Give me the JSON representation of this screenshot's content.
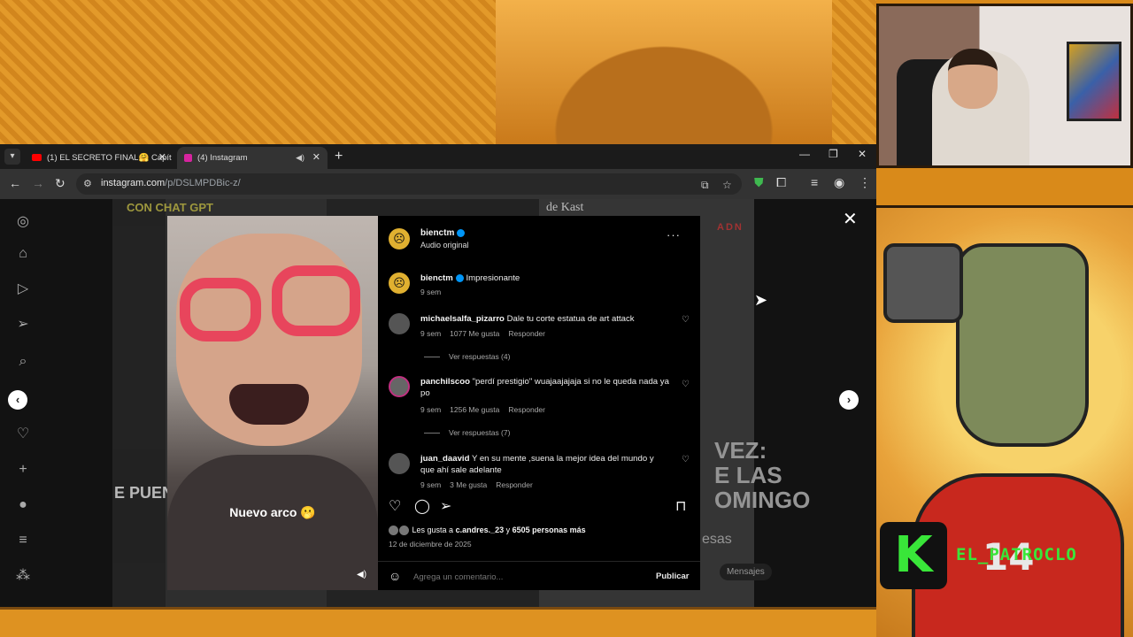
{
  "browser": {
    "tabs": [
      {
        "title": "(1) EL SECRETO FINAL🤗 Capít",
        "favicon_color": "#ff0000"
      },
      {
        "title": "(4) Instagram",
        "favicon_color": "#d6249f"
      }
    ],
    "url_host": "instagram.com",
    "url_path": "/p/DSLMPDBic-z/"
  },
  "overlay": {
    "brand_name": "EL_PATROCLO",
    "brand_logo": "K",
    "jersey_number": "14"
  },
  "background_posts": {
    "headline_1": "CON CHAT GPT",
    "headline_2": "de Kast",
    "tag": "ADN",
    "big_text": "VEZ:\nE LAS\nOMINGO",
    "puen": "E PUEN",
    "esas": "esas",
    "mensajes": "Mensajes"
  },
  "post": {
    "video_caption": "Nuevo arco 🫢",
    "author": "bienctm",
    "audio": "Audio original",
    "caption_text": "Impresionante",
    "caption_age": "9 sem",
    "comments": [
      {
        "user": "michaelsalfa_pizarro",
        "text": "Dale tu corte estatua de art attack",
        "age": "9 sem",
        "likes": "1077 Me gusta",
        "reply": "Responder",
        "view_replies": "Ver respuestas (4)"
      },
      {
        "user": "panchilscoo",
        "text": "\"perdí prestigio\" wuajaajajaja si no le queda nada ya po",
        "age": "9 sem",
        "likes": "1256 Me gusta",
        "reply": "Responder",
        "view_replies": "Ver respuestas (7)"
      },
      {
        "user": "juan_daavid",
        "text": "Y en su mente ,suena la mejor idea del mundo y que ahí sale adelante",
        "age": "9 sem",
        "likes": "3 Me gusta",
        "reply": "Responder"
      }
    ],
    "likes_prefix": "Les gusta a ",
    "likes_user": "c.andres._23",
    "likes_middle": " y ",
    "likes_count": "6505 personas más",
    "date": "12 de diciembre de 2025",
    "comment_placeholder": "Agrega un comentario...",
    "publish_label": "Publicar"
  },
  "icons": {
    "more": "···",
    "close": "✕"
  }
}
